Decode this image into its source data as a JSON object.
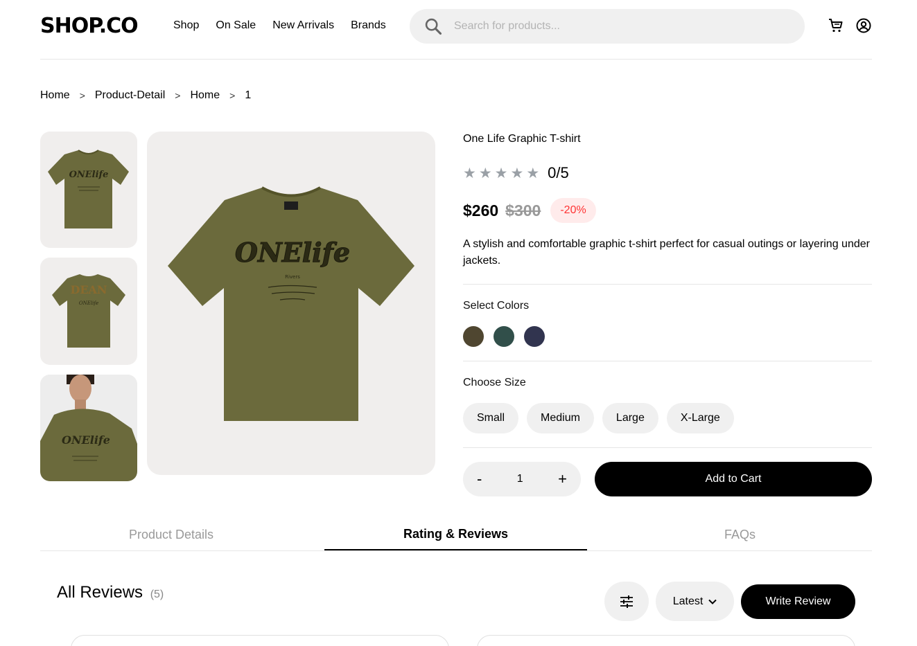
{
  "header": {
    "logo": "SHOP.CO",
    "nav": [
      "Shop",
      "On Sale",
      "New Arrivals",
      "Brands"
    ],
    "search_placeholder": "Search for products...",
    "icons": [
      "search-icon",
      "cart-icon",
      "account-icon"
    ]
  },
  "breadcrumb": [
    "Home",
    "Product-Detail",
    "Home",
    "1"
  ],
  "breadcrumb_separator": ">",
  "product": {
    "title": "One Life Graphic T-shirt",
    "rating": "0/5",
    "stars_filled": 0,
    "stars_total": 5,
    "price": "$260",
    "old_price": "$300",
    "discount": "-20%",
    "description": "A stylish and comfortable graphic t-shirt perfect for casual outings or layering under jackets.",
    "colors_label": "Select Colors",
    "colors": [
      "#4f4630",
      "#314f4a",
      "#31344f"
    ],
    "size_label": "Choose Size",
    "sizes": [
      "Small",
      "Medium",
      "Large",
      "X-Large"
    ],
    "quantity": {
      "minus": "-",
      "value": "1",
      "plus": "+"
    },
    "add_to_cart": "Add to Cart",
    "shirt_color": "#6b6a3c"
  },
  "tabs": [
    "Product Details",
    "Rating & Reviews",
    "FAQs"
  ],
  "active_tab": "Rating & Reviews",
  "reviews": {
    "title": "All Reviews",
    "count": "(5)",
    "sort": "Latest",
    "write": "Write Review"
  }
}
